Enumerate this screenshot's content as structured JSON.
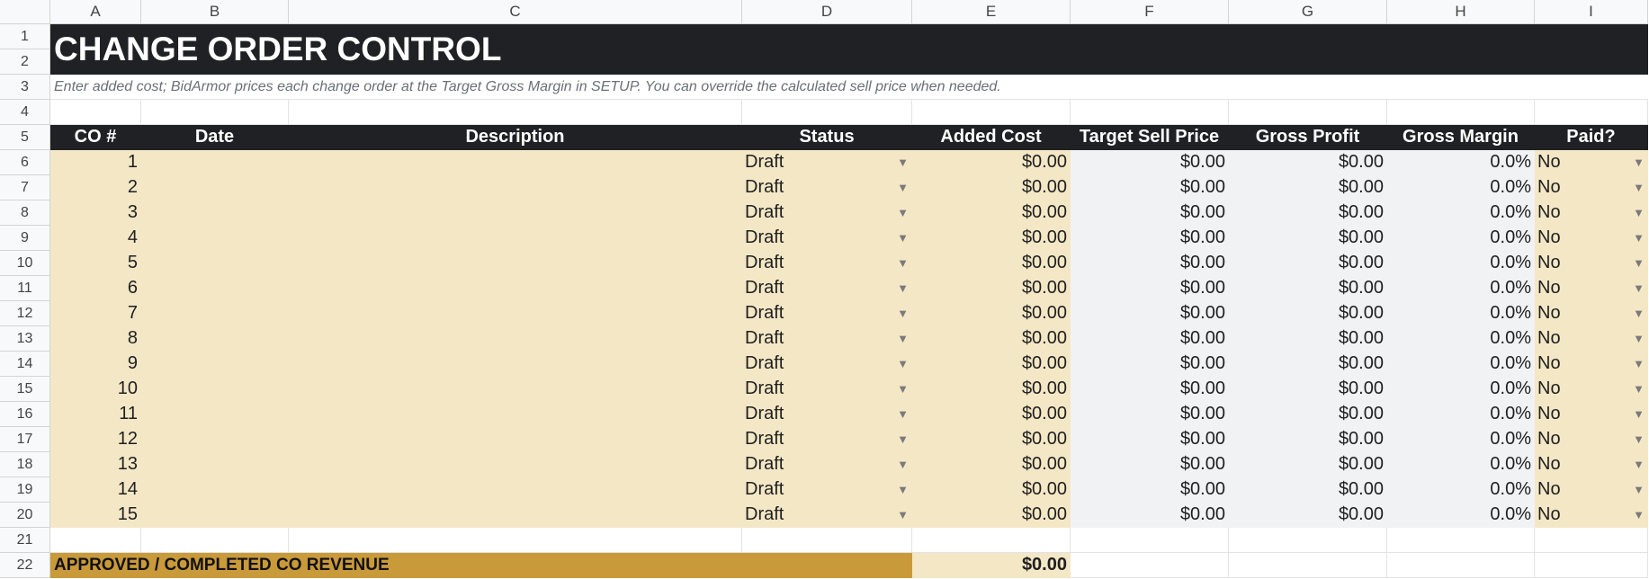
{
  "columns": [
    "A",
    "B",
    "C",
    "D",
    "E",
    "F",
    "G",
    "H",
    "I"
  ],
  "row_numbers": [
    "1",
    "2",
    "3",
    "4",
    "5",
    "6",
    "7",
    "8",
    "9",
    "10",
    "11",
    "12",
    "13",
    "14",
    "15",
    "16",
    "17",
    "18",
    "19",
    "20",
    "21",
    "22"
  ],
  "title": "CHANGE ORDER CONTROL",
  "hint": "Enter added cost; BidArmor prices each change order at the Target Gross Margin in SETUP. You can override the calculated sell price when needed.",
  "headers": {
    "co": "CO #",
    "date": "Date",
    "description": "Description",
    "status": "Status",
    "added_cost": "Added Cost",
    "target_sell_price": "Target Sell Price",
    "gross_profit": "Gross Profit",
    "gross_margin": "Gross Margin",
    "paid": "Paid?"
  },
  "rows": [
    {
      "co": "1",
      "date": "",
      "description": "",
      "status": "Draft",
      "added_cost": "$0.00",
      "target_sell_price": "$0.00",
      "gross_profit": "$0.00",
      "gross_margin": "0.0%",
      "paid": "No"
    },
    {
      "co": "2",
      "date": "",
      "description": "",
      "status": "Draft",
      "added_cost": "$0.00",
      "target_sell_price": "$0.00",
      "gross_profit": "$0.00",
      "gross_margin": "0.0%",
      "paid": "No"
    },
    {
      "co": "3",
      "date": "",
      "description": "",
      "status": "Draft",
      "added_cost": "$0.00",
      "target_sell_price": "$0.00",
      "gross_profit": "$0.00",
      "gross_margin": "0.0%",
      "paid": "No"
    },
    {
      "co": "4",
      "date": "",
      "description": "",
      "status": "Draft",
      "added_cost": "$0.00",
      "target_sell_price": "$0.00",
      "gross_profit": "$0.00",
      "gross_margin": "0.0%",
      "paid": "No"
    },
    {
      "co": "5",
      "date": "",
      "description": "",
      "status": "Draft",
      "added_cost": "$0.00",
      "target_sell_price": "$0.00",
      "gross_profit": "$0.00",
      "gross_margin": "0.0%",
      "paid": "No"
    },
    {
      "co": "6",
      "date": "",
      "description": "",
      "status": "Draft",
      "added_cost": "$0.00",
      "target_sell_price": "$0.00",
      "gross_profit": "$0.00",
      "gross_margin": "0.0%",
      "paid": "No"
    },
    {
      "co": "7",
      "date": "",
      "description": "",
      "status": "Draft",
      "added_cost": "$0.00",
      "target_sell_price": "$0.00",
      "gross_profit": "$0.00",
      "gross_margin": "0.0%",
      "paid": "No"
    },
    {
      "co": "8",
      "date": "",
      "description": "",
      "status": "Draft",
      "added_cost": "$0.00",
      "target_sell_price": "$0.00",
      "gross_profit": "$0.00",
      "gross_margin": "0.0%",
      "paid": "No"
    },
    {
      "co": "9",
      "date": "",
      "description": "",
      "status": "Draft",
      "added_cost": "$0.00",
      "target_sell_price": "$0.00",
      "gross_profit": "$0.00",
      "gross_margin": "0.0%",
      "paid": "No"
    },
    {
      "co": "10",
      "date": "",
      "description": "",
      "status": "Draft",
      "added_cost": "$0.00",
      "target_sell_price": "$0.00",
      "gross_profit": "$0.00",
      "gross_margin": "0.0%",
      "paid": "No"
    },
    {
      "co": "11",
      "date": "",
      "description": "",
      "status": "Draft",
      "added_cost": "$0.00",
      "target_sell_price": "$0.00",
      "gross_profit": "$0.00",
      "gross_margin": "0.0%",
      "paid": "No"
    },
    {
      "co": "12",
      "date": "",
      "description": "",
      "status": "Draft",
      "added_cost": "$0.00",
      "target_sell_price": "$0.00",
      "gross_profit": "$0.00",
      "gross_margin": "0.0%",
      "paid": "No"
    },
    {
      "co": "13",
      "date": "",
      "description": "",
      "status": "Draft",
      "added_cost": "$0.00",
      "target_sell_price": "$0.00",
      "gross_profit": "$0.00",
      "gross_margin": "0.0%",
      "paid": "No"
    },
    {
      "co": "14",
      "date": "",
      "description": "",
      "status": "Draft",
      "added_cost": "$0.00",
      "target_sell_price": "$0.00",
      "gross_profit": "$0.00",
      "gross_margin": "0.0%",
      "paid": "No"
    },
    {
      "co": "15",
      "date": "",
      "description": "",
      "status": "Draft",
      "added_cost": "$0.00",
      "target_sell_price": "$0.00",
      "gross_profit": "$0.00",
      "gross_margin": "0.0%",
      "paid": "No"
    }
  ],
  "total_label": "APPROVED / COMPLETED CO REVENUE",
  "total_value": "$0.00",
  "icons": {
    "dropdown": "chevron-down-icon"
  },
  "colors": {
    "header_bg": "#202124",
    "input_cream": "#f4e7c6",
    "calc_gray": "#f1f2f4",
    "total_gold": "#c99a3a",
    "hint_text": "#6b6f75"
  }
}
